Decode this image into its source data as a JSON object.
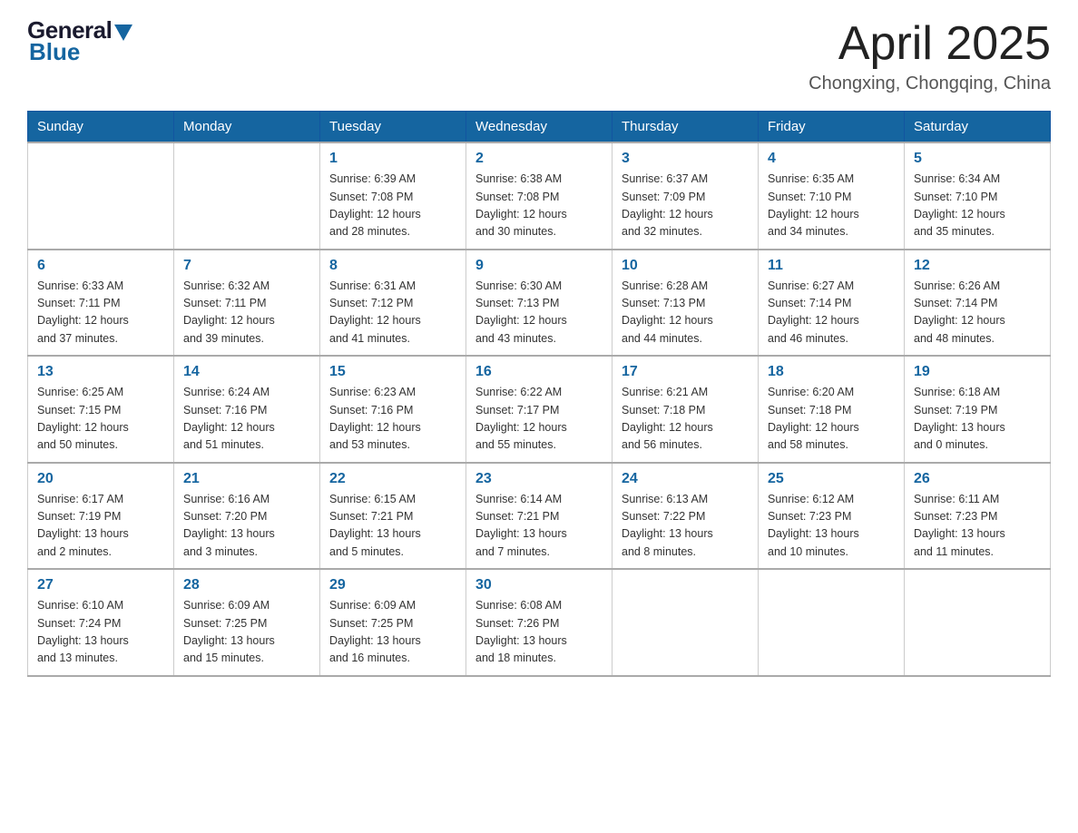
{
  "header": {
    "logo_general": "General",
    "logo_blue": "Blue",
    "month_title": "April 2025",
    "location": "Chongxing, Chongqing, China"
  },
  "weekdays": [
    "Sunday",
    "Monday",
    "Tuesday",
    "Wednesday",
    "Thursday",
    "Friday",
    "Saturday"
  ],
  "weeks": [
    [
      {
        "day": "",
        "info": ""
      },
      {
        "day": "",
        "info": ""
      },
      {
        "day": "1",
        "info": "Sunrise: 6:39 AM\nSunset: 7:08 PM\nDaylight: 12 hours\nand 28 minutes."
      },
      {
        "day": "2",
        "info": "Sunrise: 6:38 AM\nSunset: 7:08 PM\nDaylight: 12 hours\nand 30 minutes."
      },
      {
        "day": "3",
        "info": "Sunrise: 6:37 AM\nSunset: 7:09 PM\nDaylight: 12 hours\nand 32 minutes."
      },
      {
        "day": "4",
        "info": "Sunrise: 6:35 AM\nSunset: 7:10 PM\nDaylight: 12 hours\nand 34 minutes."
      },
      {
        "day": "5",
        "info": "Sunrise: 6:34 AM\nSunset: 7:10 PM\nDaylight: 12 hours\nand 35 minutes."
      }
    ],
    [
      {
        "day": "6",
        "info": "Sunrise: 6:33 AM\nSunset: 7:11 PM\nDaylight: 12 hours\nand 37 minutes."
      },
      {
        "day": "7",
        "info": "Sunrise: 6:32 AM\nSunset: 7:11 PM\nDaylight: 12 hours\nand 39 minutes."
      },
      {
        "day": "8",
        "info": "Sunrise: 6:31 AM\nSunset: 7:12 PM\nDaylight: 12 hours\nand 41 minutes."
      },
      {
        "day": "9",
        "info": "Sunrise: 6:30 AM\nSunset: 7:13 PM\nDaylight: 12 hours\nand 43 minutes."
      },
      {
        "day": "10",
        "info": "Sunrise: 6:28 AM\nSunset: 7:13 PM\nDaylight: 12 hours\nand 44 minutes."
      },
      {
        "day": "11",
        "info": "Sunrise: 6:27 AM\nSunset: 7:14 PM\nDaylight: 12 hours\nand 46 minutes."
      },
      {
        "day": "12",
        "info": "Sunrise: 6:26 AM\nSunset: 7:14 PM\nDaylight: 12 hours\nand 48 minutes."
      }
    ],
    [
      {
        "day": "13",
        "info": "Sunrise: 6:25 AM\nSunset: 7:15 PM\nDaylight: 12 hours\nand 50 minutes."
      },
      {
        "day": "14",
        "info": "Sunrise: 6:24 AM\nSunset: 7:16 PM\nDaylight: 12 hours\nand 51 minutes."
      },
      {
        "day": "15",
        "info": "Sunrise: 6:23 AM\nSunset: 7:16 PM\nDaylight: 12 hours\nand 53 minutes."
      },
      {
        "day": "16",
        "info": "Sunrise: 6:22 AM\nSunset: 7:17 PM\nDaylight: 12 hours\nand 55 minutes."
      },
      {
        "day": "17",
        "info": "Sunrise: 6:21 AM\nSunset: 7:18 PM\nDaylight: 12 hours\nand 56 minutes."
      },
      {
        "day": "18",
        "info": "Sunrise: 6:20 AM\nSunset: 7:18 PM\nDaylight: 12 hours\nand 58 minutes."
      },
      {
        "day": "19",
        "info": "Sunrise: 6:18 AM\nSunset: 7:19 PM\nDaylight: 13 hours\nand 0 minutes."
      }
    ],
    [
      {
        "day": "20",
        "info": "Sunrise: 6:17 AM\nSunset: 7:19 PM\nDaylight: 13 hours\nand 2 minutes."
      },
      {
        "day": "21",
        "info": "Sunrise: 6:16 AM\nSunset: 7:20 PM\nDaylight: 13 hours\nand 3 minutes."
      },
      {
        "day": "22",
        "info": "Sunrise: 6:15 AM\nSunset: 7:21 PM\nDaylight: 13 hours\nand 5 minutes."
      },
      {
        "day": "23",
        "info": "Sunrise: 6:14 AM\nSunset: 7:21 PM\nDaylight: 13 hours\nand 7 minutes."
      },
      {
        "day": "24",
        "info": "Sunrise: 6:13 AM\nSunset: 7:22 PM\nDaylight: 13 hours\nand 8 minutes."
      },
      {
        "day": "25",
        "info": "Sunrise: 6:12 AM\nSunset: 7:23 PM\nDaylight: 13 hours\nand 10 minutes."
      },
      {
        "day": "26",
        "info": "Sunrise: 6:11 AM\nSunset: 7:23 PM\nDaylight: 13 hours\nand 11 minutes."
      }
    ],
    [
      {
        "day": "27",
        "info": "Sunrise: 6:10 AM\nSunset: 7:24 PM\nDaylight: 13 hours\nand 13 minutes."
      },
      {
        "day": "28",
        "info": "Sunrise: 6:09 AM\nSunset: 7:25 PM\nDaylight: 13 hours\nand 15 minutes."
      },
      {
        "day": "29",
        "info": "Sunrise: 6:09 AM\nSunset: 7:25 PM\nDaylight: 13 hours\nand 16 minutes."
      },
      {
        "day": "30",
        "info": "Sunrise: 6:08 AM\nSunset: 7:26 PM\nDaylight: 13 hours\nand 18 minutes."
      },
      {
        "day": "",
        "info": ""
      },
      {
        "day": "",
        "info": ""
      },
      {
        "day": "",
        "info": ""
      }
    ]
  ]
}
